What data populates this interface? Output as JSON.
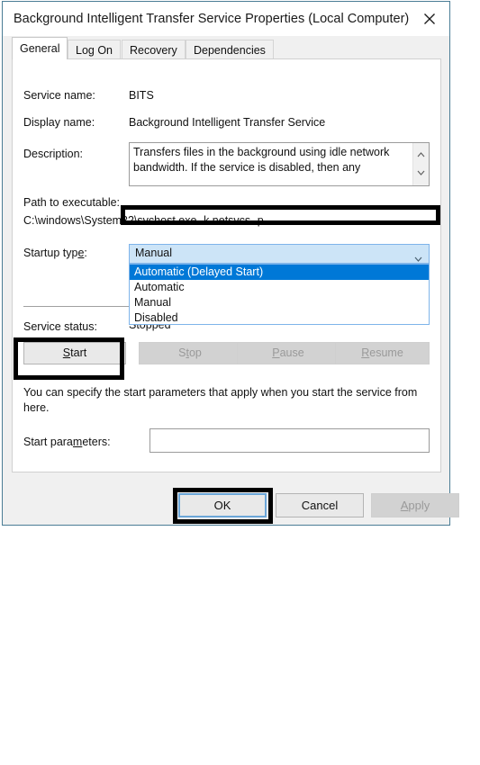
{
  "window": {
    "title": "Background Intelligent Transfer Service Properties (Local Computer)",
    "close_icon": "close-icon"
  },
  "tabs": [
    {
      "label": "General",
      "active": true
    },
    {
      "label": "Log On",
      "active": false
    },
    {
      "label": "Recovery",
      "active": false
    },
    {
      "label": "Dependencies",
      "active": false
    }
  ],
  "general": {
    "service_name_label": "Service name:",
    "service_name_value": "BITS",
    "display_name_label": "Display name:",
    "display_name_value": "Background Intelligent Transfer Service",
    "description_label": "Description:",
    "description_value": "Transfers files in the background using idle network bandwidth. If the service is disabled, then any",
    "path_label": "Path to executable:",
    "path_value": "C:\\windows\\System32\\svchost.exe -k netsvcs -p",
    "startup_type_label": "Startup type:",
    "startup_type_value": "Manual",
    "startup_type_options": [
      "Automatic (Delayed Start)",
      "Automatic",
      "Manual",
      "Disabled"
    ],
    "startup_type_selected": "Automatic (Delayed Start)",
    "service_status_label": "Service status:",
    "service_status_value": "Stopped"
  },
  "control_buttons": [
    {
      "label": "Start",
      "accel": "S",
      "enabled": true
    },
    {
      "label": "Stop",
      "accel": "t",
      "enabled": false
    },
    {
      "label": "Pause",
      "accel": "P",
      "enabled": false
    },
    {
      "label": "Resume",
      "accel": "R",
      "enabled": false
    }
  ],
  "parameters": {
    "hint": "You can specify the start parameters that apply when you start the service from here.",
    "label_pre": "Start para",
    "label_accel": "m",
    "label_post": "eters:",
    "value": "",
    "placeholder": ""
  },
  "footer": {
    "ok_label": "OK",
    "cancel_label": "Cancel",
    "apply_label_pre": "A",
    "apply_label_post": "pply",
    "apply_enabled": false
  },
  "annotations": {
    "highlight_color": "#000000",
    "items": [
      "dropdown-selected-option",
      "start-button",
      "ok-button"
    ]
  }
}
